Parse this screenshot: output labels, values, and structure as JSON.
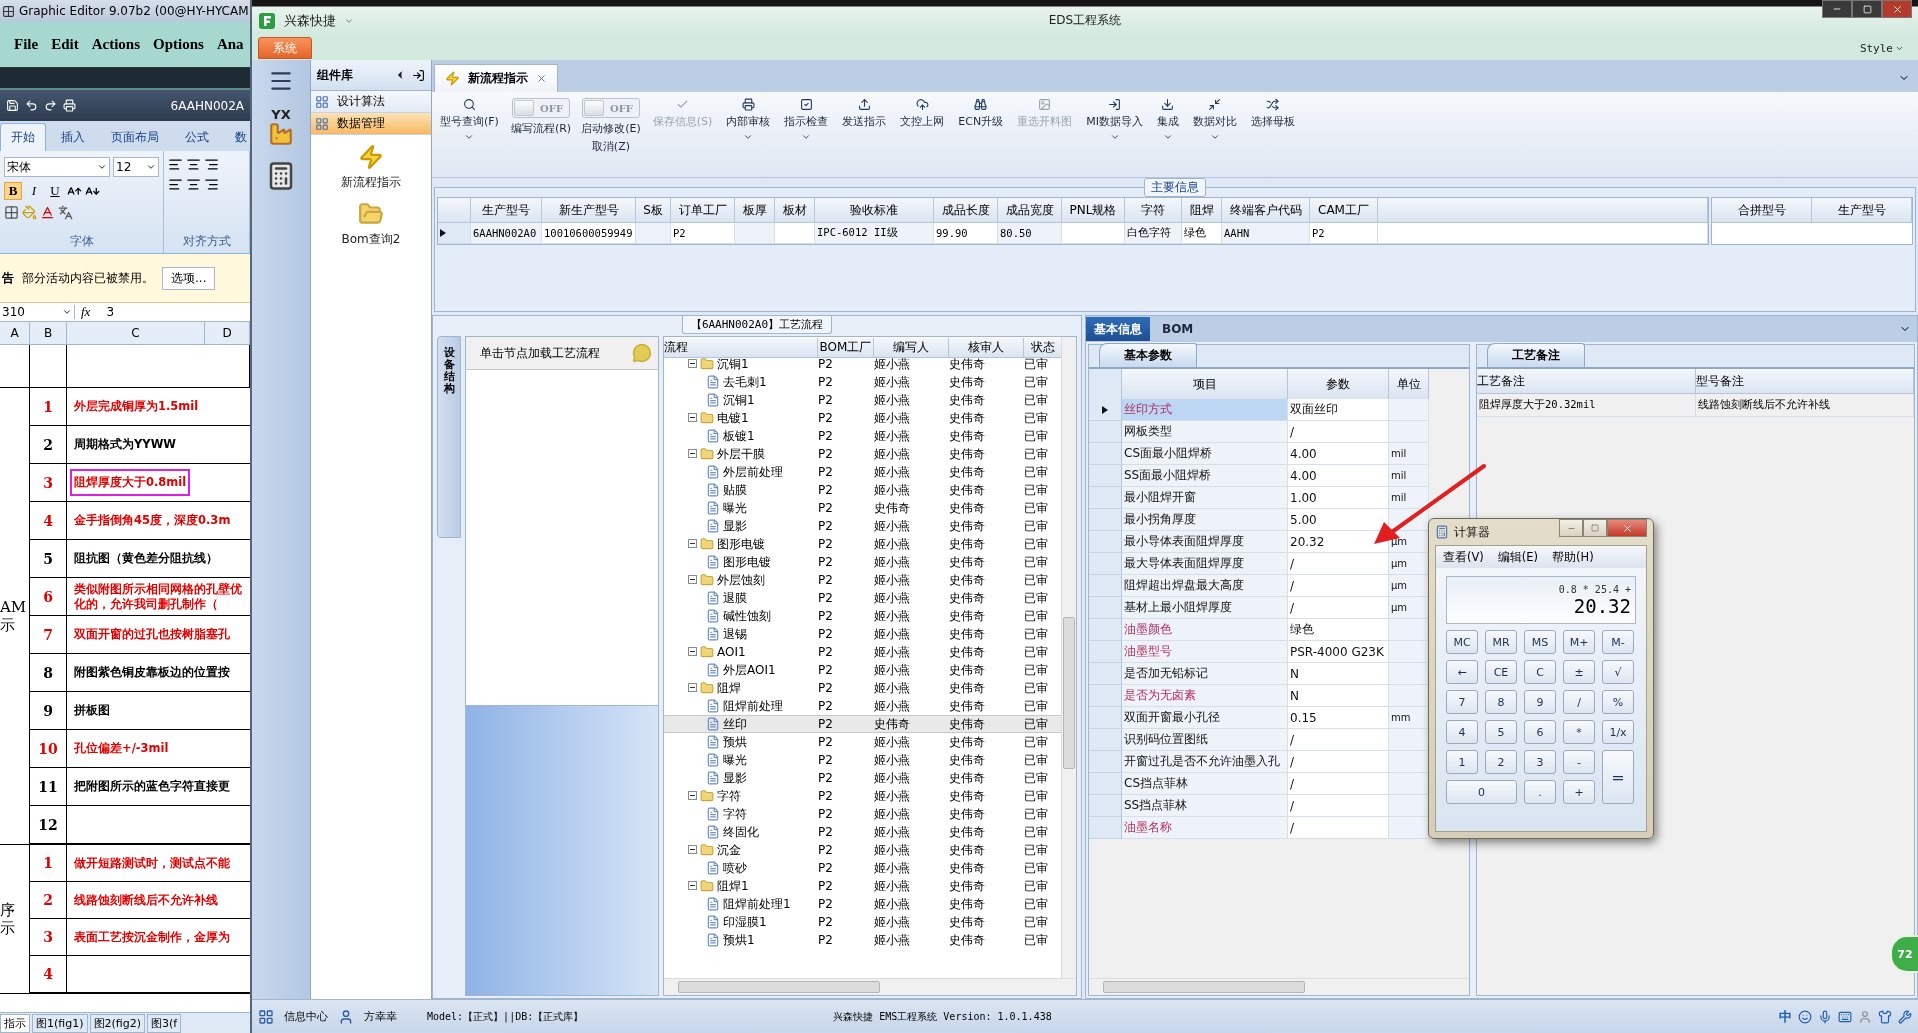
{
  "excel": {
    "window_title": "Graphic Editor 9.07b2 (00@HY-HYCAM",
    "menu": [
      "File",
      "Edit",
      "Actions",
      "Options",
      "Ana"
    ],
    "workbook_title": "6AAHN002A",
    "ribbon_tabs": [
      {
        "label": "开始",
        "selected": true
      },
      {
        "label": "插入",
        "selected": false
      },
      {
        "label": "页面布局",
        "selected": false
      },
      {
        "label": "公式",
        "selected": false
      },
      {
        "label": "数",
        "selected": false
      }
    ],
    "font_name": "宋体",
    "font_size": "12",
    "format_buttons": [
      {
        "label": "B",
        "selected": true
      },
      {
        "label": "I",
        "selected": false
      },
      {
        "label": "U",
        "selected": false
      }
    ],
    "group_labels": [
      "字体",
      "对齐方式"
    ],
    "warning": {
      "label": "告",
      "message": "部分活动内容已被禁用。",
      "button": "选项..."
    },
    "name_box": "310",
    "function_label": "fx",
    "formula": "3",
    "columns": [
      "A",
      "B",
      "C",
      "D"
    ],
    "sections": [
      {
        "label": [
          "AM",
          "示"
        ],
        "rows": [
          {
            "no": "1",
            "text": "外层完成铜厚为1.5mil",
            "color": "#e00000",
            "highlighted": false
          },
          {
            "no": "2",
            "text": "周期格式为YYWW",
            "color": "#000000",
            "highlighted": false
          },
          {
            "no": "3",
            "text": "阻焊厚度大于0.8mil",
            "color": "#e00000",
            "highlighted": true
          },
          {
            "no": "4",
            "text": "金手指倒角45度，深度0.3m",
            "color": "#e00000",
            "highlighted": false
          },
          {
            "no": "5",
            "text": "阻抗图（黄色差分阻抗线）",
            "color": "#000000",
            "highlighted": false
          },
          {
            "no": "6",
            "text": "类似附图所示相同网格的孔壁优化的，允许我司删孔制作（",
            "color": "#e00000",
            "highlighted": false
          },
          {
            "no": "7",
            "text": "双面开窗的过孔也按树脂塞孔",
            "color": "#e00000",
            "highlighted": false
          },
          {
            "no": "8",
            "text": "附图紫色铜皮靠板边的位置按",
            "color": "#000000",
            "highlighted": false
          },
          {
            "no": "9",
            "text": "拼板图",
            "color": "#000000",
            "highlighted": false
          },
          {
            "no": "10",
            "text": "孔位偏差+/-3mil",
            "color": "#e00000",
            "highlighted": false
          },
          {
            "no": "11",
            "text": "把附图所示的蓝色字符直接更",
            "color": "#000000",
            "highlighted": false
          },
          {
            "no": "12",
            "color": "#000000"
          }
        ]
      },
      {
        "label": [
          "序",
          "示"
        ],
        "rows": [
          {
            "no": "1",
            "text": "做开短路测试时，测试点不能",
            "color": "#e00000",
            "highlighted": false
          },
          {
            "no": "2",
            "text": "线路蚀刻断线后不允许补线",
            "color": "#e00000",
            "highlighted": false
          },
          {
            "no": "3",
            "text": "表面工艺按沉金制作，金厚为",
            "color": "#e00000",
            "highlighted": false
          },
          {
            "no": "4",
            "color": "#e00000"
          }
        ]
      }
    ],
    "sheet_tabs": [
      {
        "label": "指示",
        "selected": true
      },
      {
        "label": "图1(fig1)",
        "selected": false
      },
      {
        "label": "图2(fig2)",
        "selected": false
      },
      {
        "label": "图3(f",
        "selected": false
      }
    ]
  },
  "app": {
    "title": "兴森快捷",
    "system_title": "EDS工程系统",
    "menu": [
      {
        "label": "系统",
        "selected": true
      }
    ],
    "style_label": "Style",
    "nav_badge": "YX",
    "library": {
      "title": "组件库",
      "groups": [
        {
          "label": "设计算法",
          "selected": false
        },
        {
          "label": "数据管理",
          "selected": true
        }
      ],
      "items": [
        "新流程指示",
        "Bom查询2"
      ]
    },
    "tabs": [
      {
        "label": "新流程指示",
        "selected": true
      }
    ],
    "toolbar": [
      {
        "kind": "button",
        "label": "型号查询(F)",
        "dropdown": true,
        "disabled": false
      },
      {
        "kind": "toggle",
        "toggle_text": "OFF",
        "on": false,
        "label": "编写流程(R)"
      },
      {
        "kind": "toggle",
        "toggle_text": "OFF",
        "on": false,
        "label": "启动修改(E)",
        "sublabel": "取消(Z)"
      },
      {
        "kind": "button",
        "label": "保存信息(S)",
        "dropdown": false,
        "disabled": true
      },
      {
        "kind": "button",
        "label": "内部审核",
        "dropdown": true,
        "disabled": false
      },
      {
        "kind": "button",
        "label": "指示检查",
        "dropdown": true,
        "disabled": false
      },
      {
        "kind": "button",
        "label": "发送指示",
        "dropdown": false,
        "disabled": false
      },
      {
        "kind": "button",
        "label": "文控上网",
        "dropdown": false,
        "disabled": false
      },
      {
        "kind": "button",
        "label": "ECN升级",
        "dropdown": false,
        "disabled": false
      },
      {
        "kind": "button",
        "label": "重选开料图",
        "dropdown": false,
        "disabled": true
      },
      {
        "kind": "button",
        "label": "MI数据导入",
        "dropdown": true,
        "disabled": false
      },
      {
        "kind": "button",
        "label": "集成",
        "dropdown": true,
        "disabled": false
      },
      {
        "kind": "button",
        "label": "数据对比",
        "dropdown": true,
        "disabled": false
      },
      {
        "kind": "button",
        "label": "选择母板",
        "dropdown": false,
        "disabled": false
      }
    ],
    "main_info": {
      "title": "主要信息",
      "columns": [
        "生产型号",
        "新生产型号",
        "S板",
        "订单工厂",
        "板厚",
        "板材",
        "验收标准",
        "成品长度",
        "成品宽度",
        "PNL规格",
        "字符",
        "阻焊",
        "终端客户代码",
        "CAM工厂"
      ],
      "rows": [
        [
          "6AAHN002A0",
          "10010600059949",
          null,
          "P2",
          null,
          null,
          "IPC-6012 II级",
          "99.90",
          "80.50",
          null,
          "白色字符",
          "绿色",
          "AAHN",
          "P2"
        ]
      ],
      "side_columns": [
        "合拼型号",
        "生产型号"
      ]
    },
    "process": {
      "title": "【6AAHN002A0】工艺流程",
      "side_tab": "设备结构",
      "hint": "单击节点加载工艺流程",
      "columns": [
        "流程",
        "BOM工厂",
        "编写人",
        "核审人",
        "状态"
      ],
      "tree": [
        {
          "name": "沉铜1",
          "factory": "P2",
          "writer": "姬小燕",
          "reviewer": "史伟奇",
          "status": "已审",
          "selected": false,
          "expanded": true,
          "children": [
            {
              "name": "去毛刺1",
              "factory": "P2",
              "writer": "姬小燕",
              "reviewer": "史伟奇",
              "status": "已审",
              "selected": false
            },
            {
              "name": "沉铜1",
              "factory": "P2",
              "writer": "姬小燕",
              "reviewer": "史伟奇",
              "status": "已审",
              "selected": false
            }
          ]
        },
        {
          "name": "电镀1",
          "factory": "P2",
          "writer": "姬小燕",
          "reviewer": "史伟奇",
          "status": "已审",
          "selected": false,
          "expanded": true,
          "children": [
            {
              "name": "板镀1",
              "factory": "P2",
              "writer": "姬小燕",
              "reviewer": "史伟奇",
              "status": "已审",
              "selected": false
            }
          ]
        },
        {
          "name": "外层干膜",
          "factory": "P2",
          "writer": "姬小燕",
          "reviewer": "史伟奇",
          "status": "已审",
          "selected": false,
          "expanded": true,
          "children": [
            {
              "name": "外层前处理",
              "factory": "P2",
              "writer": "姬小燕",
              "reviewer": "史伟奇",
              "status": "已审",
              "selected": false
            },
            {
              "name": "贴膜",
              "factory": "P2",
              "writer": "姬小燕",
              "reviewer": "史伟奇",
              "status": "已审",
              "selected": false
            },
            {
              "name": "曝光",
              "factory": "P2",
              "writer": "史伟奇",
              "reviewer": "史伟奇",
              "status": "已审",
              "selected": false
            },
            {
              "name": "显影",
              "factory": "P2",
              "writer": "姬小燕",
              "reviewer": "史伟奇",
              "status": "已审",
              "selected": false
            }
          ]
        },
        {
          "name": "图形电镀",
          "factory": "P2",
          "writer": "姬小燕",
          "reviewer": "史伟奇",
          "status": "已审",
          "selected": false,
          "expanded": true,
          "children": [
            {
              "name": "图形电镀",
              "factory": "P2",
              "writer": "姬小燕",
              "reviewer": "史伟奇",
              "status": "已审",
              "selected": false
            }
          ]
        },
        {
          "name": "外层蚀刻",
          "factory": "P2",
          "writer": "姬小燕",
          "reviewer": "史伟奇",
          "status": "已审",
          "selected": false,
          "expanded": true,
          "children": [
            {
              "name": "退膜",
              "factory": "P2",
              "writer": "姬小燕",
              "reviewer": "史伟奇",
              "status": "已审",
              "selected": false
            },
            {
              "name": "碱性蚀刻",
              "factory": "P2",
              "writer": "姬小燕",
              "reviewer": "史伟奇",
              "status": "已审",
              "selected": false
            },
            {
              "name": "退锡",
              "factory": "P2",
              "writer": "姬小燕",
              "reviewer": "史伟奇",
              "status": "已审",
              "selected": false
            }
          ]
        },
        {
          "name": "AOI1",
          "factory": "P2",
          "writer": "姬小燕",
          "reviewer": "史伟奇",
          "status": "已审",
          "selected": false,
          "expanded": true,
          "children": [
            {
              "name": "外层AOI1",
              "factory": "P2",
              "writer": "姬小燕",
              "reviewer": "史伟奇",
              "status": "已审",
              "selected": false
            }
          ]
        },
        {
          "name": "阻焊",
          "factory": "P2",
          "writer": "姬小燕",
          "reviewer": "史伟奇",
          "status": "已审",
          "selected": false,
          "expanded": true,
          "children": [
            {
              "name": "阻焊前处理",
              "factory": "P2",
              "writer": "姬小燕",
              "reviewer": "史伟奇",
              "status": "已审",
              "selected": false
            },
            {
              "name": "丝印",
              "factory": "P2",
              "writer": "史伟奇",
              "reviewer": "史伟奇",
              "status": "已审",
              "selected": true
            },
            {
              "name": "预烘",
              "factory": "P2",
              "writer": "姬小燕",
              "reviewer": "史伟奇",
              "status": "已审",
              "selected": false
            },
            {
              "name": "曝光",
              "factory": "P2",
              "writer": "姬小燕",
              "reviewer": "史伟奇",
              "status": "已审",
              "selected": false
            },
            {
              "name": "显影",
              "factory": "P2",
              "writer": "姬小燕",
              "reviewer": "史伟奇",
              "status": "已审",
              "selected": false
            }
          ]
        },
        {
          "name": "字符",
          "factory": "P2",
          "writer": "姬小燕",
          "reviewer": "史伟奇",
          "status": "已审",
          "selected": false,
          "expanded": true,
          "children": [
            {
              "name": "字符",
              "factory": "P2",
              "writer": "姬小燕",
              "reviewer": "史伟奇",
              "status": "已审",
              "selected": false
            },
            {
              "name": "终固化",
              "factory": "P2",
              "writer": "姬小燕",
              "reviewer": "史伟奇",
              "status": "已审",
              "selected": false
            }
          ]
        },
        {
          "name": "沉金",
          "factory": "P2",
          "writer": "姬小燕",
          "reviewer": "史伟奇",
          "status": "已审",
          "selected": false,
          "expanded": true,
          "children": [
            {
              "name": "喷砂",
              "factory": "P2",
              "writer": "姬小燕",
              "reviewer": "史伟奇",
              "status": "已审",
              "selected": false
            }
          ]
        },
        {
          "name": "阻焊1",
          "factory": "P2",
          "writer": "姬小燕",
          "reviewer": "史伟奇",
          "status": "已审",
          "selected": false,
          "expanded": true,
          "children": [
            {
              "name": "阻焊前处理1",
              "factory": "P2",
              "writer": "姬小燕",
              "reviewer": "史伟奇",
              "status": "已审",
              "selected": false
            },
            {
              "name": "印湿膜1",
              "factory": "P2",
              "writer": "姬小燕",
              "reviewer": "史伟奇",
              "status": "已审",
              "selected": false
            },
            {
              "name": "预烘1",
              "factory": "P2",
              "writer": "姬小燕",
              "reviewer": "史伟奇",
              "status": "已审",
              "selected": false
            }
          ]
        }
      ]
    },
    "detail": {
      "tabs": [
        {
          "label": "基本信息",
          "selected": true
        },
        {
          "label": "BOM",
          "selected": false
        }
      ],
      "params": {
        "title": "基本参数",
        "columns": [
          "项目",
          "参数",
          "单位"
        ],
        "rows": [
          {
            "name": "丝印方式",
            "value": "双面丝印",
            "emphasized": true,
            "selected": true
          },
          {
            "name": "网板类型",
            "value": "/",
            "emphasized": false,
            "selected": false
          },
          {
            "name": "CS面最小阻焊桥",
            "value": "4.00",
            "unit": "mil",
            "emphasized": false,
            "selected": false
          },
          {
            "name": "SS面最小阻焊桥",
            "value": "4.00",
            "unit": "mil",
            "emphasized": false,
            "selected": false
          },
          {
            "name": "最小阻焊开窗",
            "value": "1.00",
            "unit": "mil",
            "emphasized": false,
            "selected": false
          },
          {
            "name": "最小拐角厚度",
            "value": "5.00",
            "emphasized": false,
            "selected": false
          },
          {
            "name": "最小导体表面阻焊厚度",
            "value": "20.32",
            "unit": "μm",
            "emphasized": false,
            "selected": false
          },
          {
            "name": "最大导体表面阻焊厚度",
            "value": "/",
            "unit": "μm",
            "emphasized": false,
            "selected": false
          },
          {
            "name": "阻焊超出焊盘最大高度",
            "value": "/",
            "unit": "μm",
            "emphasized": false,
            "selected": false
          },
          {
            "name": "基材上最小阻焊厚度",
            "value": "/",
            "unit": "μm",
            "emphasized": false,
            "selected": false
          },
          {
            "name": "油墨颜色",
            "value": "绿色",
            "emphasized": true,
            "selected": false
          },
          {
            "name": "油墨型号",
            "value": "PSR-4000 G23K",
            "emphasized": true,
            "selected": false
          },
          {
            "name": "是否加无铅标记",
            "value": "N",
            "emphasized": false,
            "selected": false
          },
          {
            "name": "是否为无卤素",
            "value": "N",
            "emphasized": true,
            "selected": false
          },
          {
            "name": "双面开窗最小孔径",
            "value": "0.15",
            "unit": "mm",
            "emphasized": false,
            "selected": false
          },
          {
            "name": "识别码位置图纸",
            "value": "/",
            "emphasized": false,
            "selected": false
          },
          {
            "name": "开窗过孔是否不允许油墨入孔",
            "value": "/",
            "emphasized": false,
            "selected": false
          },
          {
            "name": "CS挡点菲林",
            "value": "/",
            "emphasized": false,
            "selected": false
          },
          {
            "name": "SS挡点菲林",
            "value": "/",
            "emphasized": false,
            "selected": false
          },
          {
            "name": "油墨名称",
            "value": "/",
            "emphasized": true,
            "selected": false
          }
        ]
      },
      "notes": {
        "title": "工艺备注",
        "columns": [
          "工艺备注",
          "型号备注"
        ],
        "rows": [
          [
            "阻焊厚度大于20.32mil",
            "线路蚀刻断线后不允许补线"
          ]
        ]
      }
    },
    "status_bar": {
      "items": [
        "信息中心",
        "方幸幸"
      ],
      "model": "Model:【正式】||DB:【正式库】",
      "version": "兴森快捷 EMS工程系统 Version: 1.0.1.438",
      "ime": "中"
    }
  },
  "calculator": {
    "title": "计算器",
    "menu": [
      "查看(V)",
      "编辑(E)",
      "帮助(H)"
    ],
    "expression": "0.8 * 25.4 +",
    "value": "20.32",
    "keys": [
      {
        "label": "MC",
        "kind": "key"
      },
      {
        "label": "MR",
        "kind": "key"
      },
      {
        "label": "MS",
        "kind": "key"
      },
      {
        "label": "M+",
        "kind": "key"
      },
      {
        "label": "M-",
        "kind": "key"
      },
      {
        "label": "←",
        "kind": "key"
      },
      {
        "label": "CE",
        "kind": "key"
      },
      {
        "label": "C",
        "kind": "key"
      },
      {
        "label": "±",
        "kind": "key"
      },
      {
        "label": "√",
        "kind": "key"
      },
      {
        "label": "7",
        "kind": "key"
      },
      {
        "label": "8",
        "kind": "key"
      },
      {
        "label": "9",
        "kind": "key"
      },
      {
        "label": "/",
        "kind": "key"
      },
      {
        "label": "%",
        "kind": "key"
      },
      {
        "label": "4",
        "kind": "key"
      },
      {
        "label": "5",
        "kind": "key"
      },
      {
        "label": "6",
        "kind": "key"
      },
      {
        "label": "*",
        "kind": "key"
      },
      {
        "label": "1/x",
        "kind": "key"
      },
      {
        "label": "1",
        "kind": "key"
      },
      {
        "label": "2",
        "kind": "key"
      },
      {
        "label": "3",
        "kind": "key"
      },
      {
        "label": "-",
        "kind": "key"
      },
      {
        "label": "=",
        "kind": "tall"
      },
      {
        "label": "0",
        "kind": "wide"
      },
      {
        "label": ".",
        "kind": "key"
      },
      {
        "label": "+",
        "kind": "key"
      }
    ]
  },
  "floating_badge": "72"
}
